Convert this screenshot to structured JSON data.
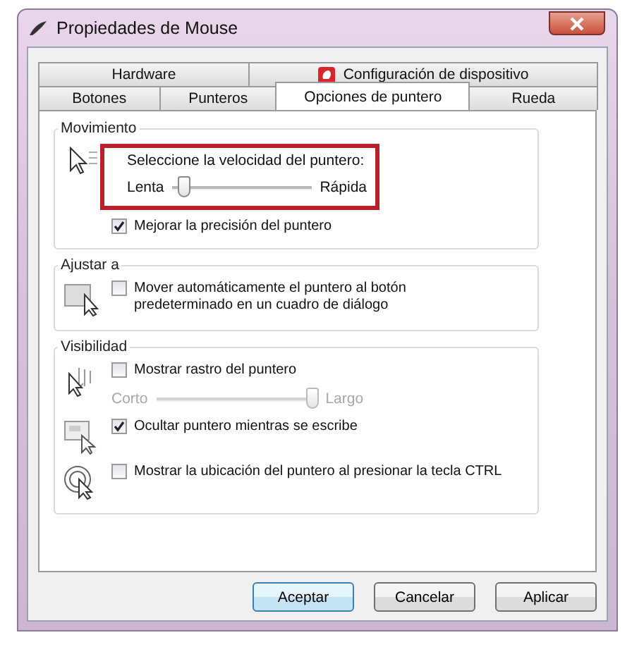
{
  "window": {
    "title": "Propiedades de Mouse"
  },
  "tab_rows": [
    [
      {
        "label": "Hardware",
        "selected": false,
        "has_icon": false
      },
      {
        "label": "Configuración de dispositivo",
        "selected": false,
        "has_icon": true
      }
    ],
    [
      {
        "label": "Botones",
        "selected": false,
        "has_icon": false
      },
      {
        "label": "Punteros",
        "selected": false,
        "has_icon": false
      },
      {
        "label": "Opciones de puntero",
        "selected": true,
        "has_icon": false
      },
      {
        "label": "Rueda",
        "selected": false,
        "has_icon": false
      }
    ]
  ],
  "groups": [
    {
      "title": "Movimiento",
      "rows": [
        {
          "controls": [
            {
              "kind": "slider",
              "label": "Seleccione la velocidad del puntero:",
              "min_label": "Lenta",
              "max_label": "Rápida",
              "level": 0.05,
              "disabled": false,
              "highlighted": true
            },
            {
              "kind": "checkbox",
              "label": "Mejorar la precisión del puntero",
              "checked": true
            }
          ]
        }
      ]
    },
    {
      "title": "Ajustar a",
      "rows": [
        {
          "controls": [
            {
              "kind": "checkbox",
              "label": "Mover automáticamente el puntero al botón predeterminado en un cuadro de diálogo",
              "checked": false
            }
          ]
        }
      ]
    },
    {
      "title": "Visibilidad",
      "rows": [
        {
          "controls": [
            {
              "kind": "checkbox",
              "label": "Mostrar rastro del puntero",
              "checked": false
            },
            {
              "kind": "slider",
              "min_label": "Corto",
              "max_label": "Largo",
              "level": 1,
              "disabled": true,
              "highlighted": false
            }
          ]
        },
        {
          "controls": [
            {
              "kind": "checkbox",
              "label": "Ocultar puntero mientras se escribe",
              "checked": true
            }
          ]
        },
        {
          "controls": [
            {
              "kind": "checkbox",
              "label": "Mostrar la ubicación del puntero al presionar la tecla CTRL",
              "checked": false
            }
          ]
        }
      ]
    }
  ],
  "buttons": [
    {
      "label": "Aceptar",
      "default": true
    },
    {
      "label": "Cancelar",
      "default": false
    },
    {
      "label": "Aplicar",
      "default": false
    }
  ]
}
